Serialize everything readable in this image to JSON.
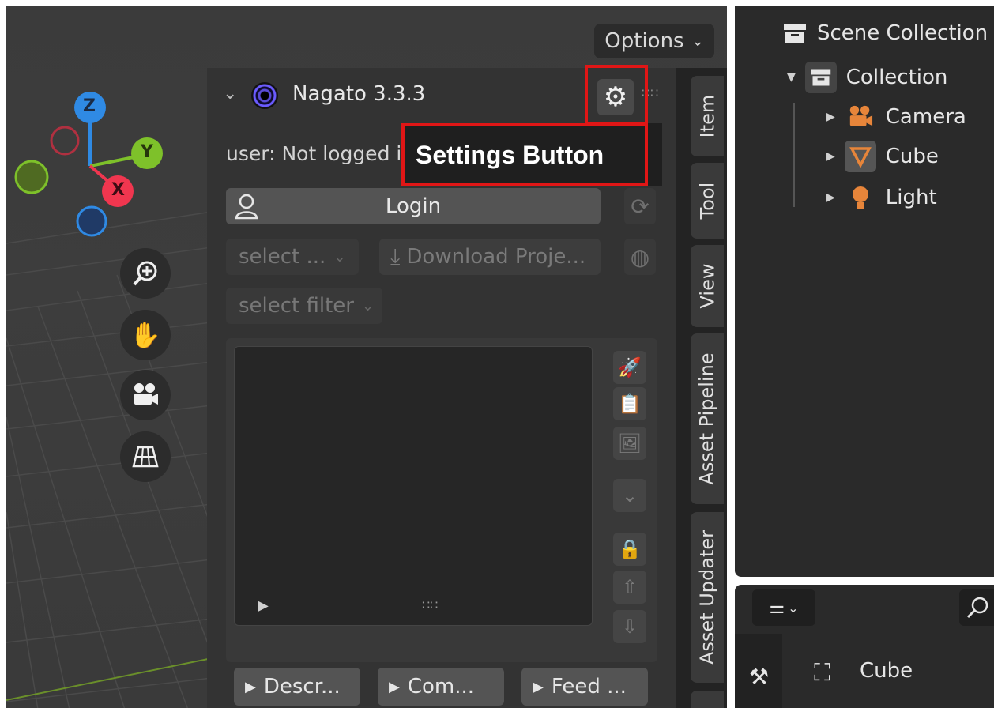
{
  "viewport": {
    "options_label": "Options",
    "gizmo": {
      "z": "Z",
      "y": "Y",
      "x": "X"
    }
  },
  "addon_panel": {
    "title": "Nagato 3.3.3",
    "user_status": "user: Not logged in",
    "login_label": "Login",
    "select_project_placeholder": "select ...",
    "download_label": "Download Proje...",
    "select_filter_placeholder": "select filter",
    "buttons": {
      "description": "Descr...",
      "comment": "Com...",
      "feedback": "Feed ..."
    }
  },
  "annotation": {
    "label": "Settings Button",
    "color": "#e01616"
  },
  "sidebar_tabs": [
    "Item",
    "Tool",
    "View",
    "Asset Pipeline",
    "Asset Updater"
  ],
  "outliner": {
    "scene_collection": "Scene Collection",
    "collection": "Collection",
    "items": [
      "Camera",
      "Cube",
      "Light"
    ]
  },
  "properties": {
    "object_name": "Cube"
  },
  "colors": {
    "accent_orange": "#e7853a",
    "panel_bg": "#333333",
    "gizmo_z": "#2f8ae4",
    "gizmo_y": "#7ec12a",
    "gizmo_x": "#f0364f"
  }
}
